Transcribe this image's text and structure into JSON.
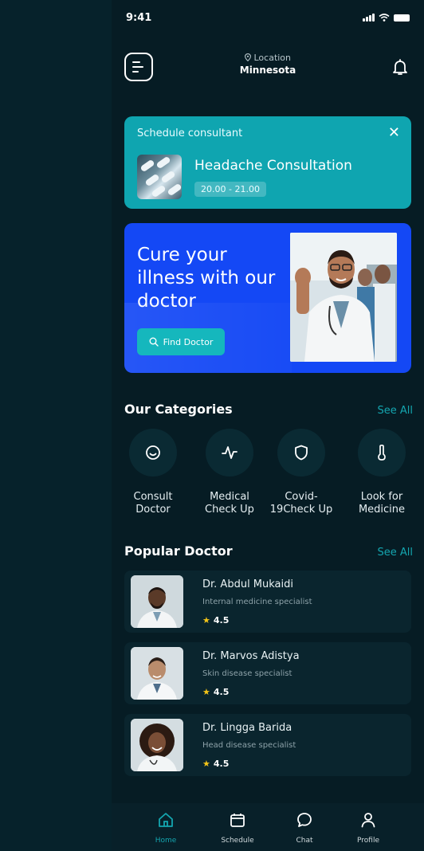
{
  "status_bar": {
    "time": "9:41"
  },
  "header": {
    "location_label": "Location",
    "location_value": "Minnesota"
  },
  "schedule": {
    "title": "Schedule consultant",
    "close_glyph": "✕",
    "name": "Headache Consultation",
    "time": "20.00 - 21.00"
  },
  "promo": {
    "text": "Cure your illness with our doctor",
    "button_label": "Find Doctor"
  },
  "categories": {
    "title": "Our Categories",
    "see_all": "See All",
    "items": [
      {
        "label": "Consult Doctor",
        "icon": "smile-icon"
      },
      {
        "label": "Medical Check Up",
        "icon": "pulse-icon"
      },
      {
        "label": "Covid-19Check Up",
        "icon": "shield-icon"
      },
      {
        "label": "Look for Medicine",
        "icon": "thermometer-icon"
      }
    ]
  },
  "popular": {
    "title": "Popular Doctor",
    "see_all": "See All",
    "doctors": [
      {
        "name": "Dr. Abdul Mukaidi",
        "specialty": "Internal medicine specialist",
        "rating": "4.5"
      },
      {
        "name": "Dr. Marvos Adistya",
        "specialty": "Skin disease specialist",
        "rating": "4.5"
      },
      {
        "name": "Dr. Lingga Barida",
        "specialty": "Head disease specialist",
        "rating": "4.5"
      }
    ]
  },
  "nav": {
    "items": [
      {
        "label": "Home",
        "icon": "home-icon",
        "active": true
      },
      {
        "label": "Schedule",
        "icon": "calendar-icon",
        "active": false
      },
      {
        "label": "Chat",
        "icon": "chat-icon",
        "active": false
      },
      {
        "label": "Profile",
        "icon": "user-icon",
        "active": false
      }
    ]
  },
  "colors": {
    "background": "#061c24",
    "accent": "#14a6b0",
    "schedule_card": "#0fa5b0",
    "promo_card": "#1448f5",
    "star": "#f5c518"
  }
}
